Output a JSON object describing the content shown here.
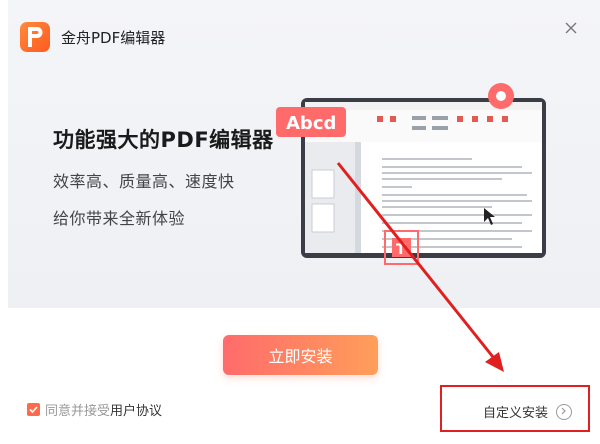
{
  "window": {
    "title": "金舟PDF编辑器"
  },
  "hero": {
    "headline": "功能强大的PDF编辑器",
    "subline1": "效率高、质量高、速度快",
    "subline2": "给你带来全新体验",
    "illustration_text": "Abcd"
  },
  "actions": {
    "install_label": "立即安装",
    "agree_prefix": "同意并接受",
    "agree_link": "用户协议",
    "agree_checked": true,
    "custom_install_label": "自定义安装"
  },
  "colors": {
    "accent": "#ff6b4a",
    "button_gradient_start": "#ff6b6b",
    "button_gradient_end": "#ff9e5a",
    "annotation_red": "#e02020"
  }
}
